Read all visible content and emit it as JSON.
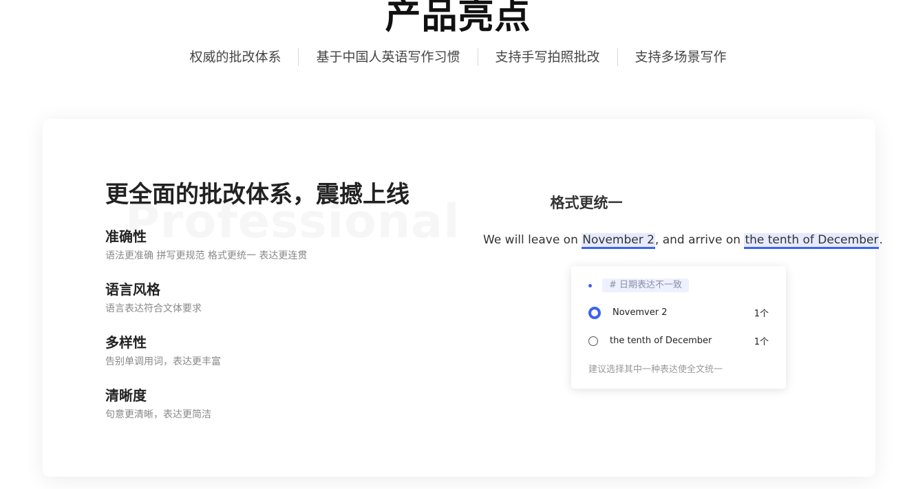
{
  "header": {
    "title": "产品亮点",
    "tabs": [
      {
        "label": "权威的批改体系"
      },
      {
        "label": "基于中国人英语写作习惯"
      },
      {
        "label": "支持手写拍照批改"
      },
      {
        "label": "支持多场景写作"
      }
    ]
  },
  "card": {
    "watermark": "Professional",
    "heading": "更全面的批改体系，震撼上线",
    "features": [
      {
        "title": "准确性",
        "desc": "语法更准确 拼写更规范 格式更统一 表达更连贯"
      },
      {
        "title": "语言风格",
        "desc": "语言表达符合文体要求"
      },
      {
        "title": "多样性",
        "desc": "告别单调用词，表达更丰富"
      },
      {
        "title": "清晰度",
        "desc": "句意更清晰，表达更简洁"
      }
    ],
    "demo": {
      "title": "格式更统一",
      "sentence": {
        "part1": "We will leave on ",
        "highlight1": "November 2",
        "part2": ", and arrive on ",
        "highlight2": "the tenth of December",
        "part3": "."
      },
      "popup": {
        "tag": "# 日期表达不一致",
        "options": [
          {
            "label": "Novemver 2",
            "count": "1个",
            "selected": true
          },
          {
            "label": "the tenth of December",
            "count": "1个",
            "selected": false
          }
        ],
        "hint": "建议选择其中一种表达使全文统一"
      }
    }
  },
  "colors": {
    "accent": "#3a63f0",
    "highlight_bg": "#e6eafe"
  }
}
